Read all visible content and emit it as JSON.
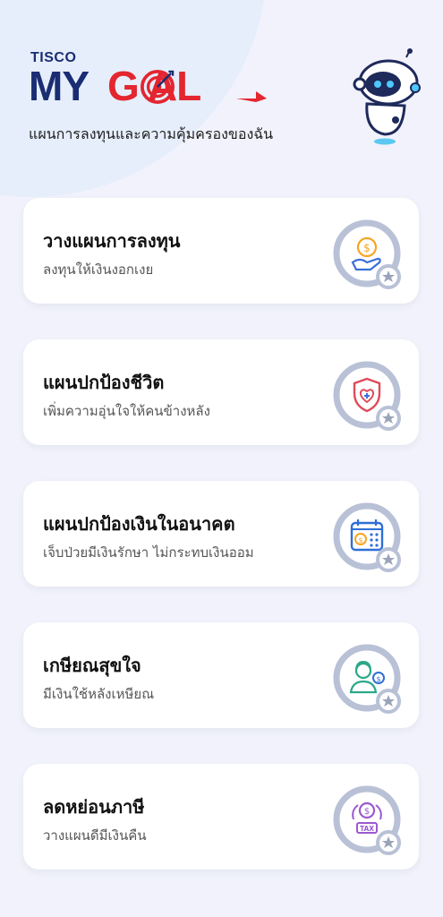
{
  "header": {
    "brand_small": "TISCO",
    "logo_my": "MY",
    "logo_goal": "G  AL",
    "tagline": "แผนการลงทุนและความคุ้มครองของฉัน"
  },
  "menu": {
    "items": [
      {
        "title": "วางแผนการลงทุน",
        "subtitle": "ลงทุนให้เงินงอกเงย",
        "icon": "investment-icon"
      },
      {
        "title": "แผนปกป้องชีวิต",
        "subtitle": "เพิ่มความอุ่นใจให้คนข้างหลัง",
        "icon": "shield-heart-icon"
      },
      {
        "title": "แผนปกป้องเงินในอนาคต",
        "subtitle": "เจ็บป่วยมีเงินรักษา ไม่กระทบเงินออม",
        "icon": "calendar-money-icon"
      },
      {
        "title": "เกษียณสุขใจ",
        "subtitle": "มีเงินใช้หลังเหษียณ",
        "icon": "retiree-icon"
      },
      {
        "title": "ลดหย่อนภาษี",
        "subtitle": "วางแผนดีมีเงินคืน",
        "icon": "tax-icon"
      }
    ]
  },
  "colors": {
    "navy": "#1a2d72",
    "red": "#e3262f",
    "background": "#f1f2fb",
    "card": "#ffffff",
    "ring": "#b8c1d6"
  }
}
